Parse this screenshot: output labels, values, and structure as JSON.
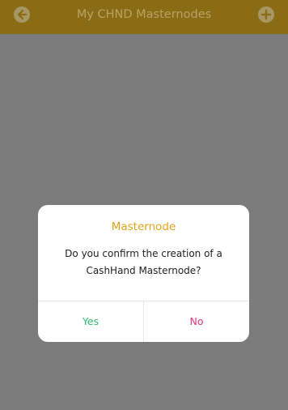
{
  "header": {
    "title": "My CHND Masternodes",
    "back_icon": "arrow-left-circle-icon",
    "add_icon": "plus-circle-icon"
  },
  "dialog": {
    "title": "Masternode",
    "message": "Do you confirm the creation of a CashHand Masternode?",
    "yes_label": "Yes",
    "no_label": "No"
  },
  "colors": {
    "header_bg": "#8a6b16",
    "accent": "#e2a11b",
    "yes": "#2bb673",
    "no": "#e2337d",
    "overlay": "#7b7b7b"
  }
}
